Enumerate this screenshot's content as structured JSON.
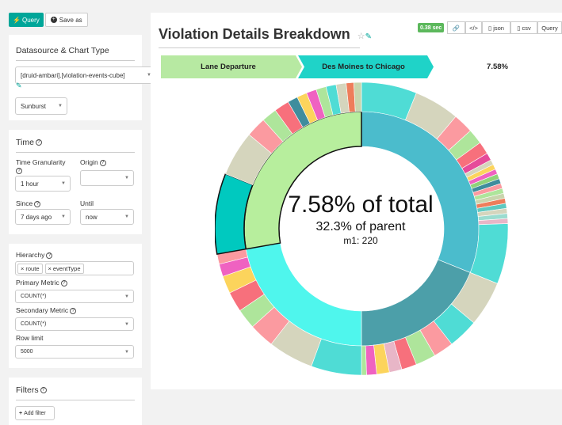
{
  "toolbar": {
    "query_label": "Query",
    "save_label": "Save as"
  },
  "datasource_panel": {
    "heading": "Datasource & Chart Type",
    "datasource_value": "[druid-ambari].[violation-events-cube]",
    "chart_type_value": "Sunburst"
  },
  "time_panel": {
    "heading": "Time",
    "granularity_label": "Time Granularity",
    "granularity_value": "1 hour",
    "origin_label": "Origin",
    "origin_value": "",
    "since_label": "Since",
    "since_value": "7 days ago",
    "until_label": "Until",
    "until_value": "now"
  },
  "query_panel": {
    "hierarchy_label": "Hierarchy",
    "hierarchy_tags": [
      "route",
      "eventType"
    ],
    "primary_metric_label": "Primary Metric",
    "primary_metric_value": "COUNT(*)",
    "secondary_metric_label": "Secondary Metric",
    "secondary_metric_value": "COUNT(*)",
    "row_limit_label": "Row limit",
    "row_limit_value": "5000"
  },
  "filters_panel": {
    "heading": "Filters",
    "add_filter_label": "Add filter"
  },
  "chart_header": {
    "title": "Violation Details Breakdown",
    "timing_badge": "0.38 sec",
    "json_label": "json",
    "csv_label": "csv",
    "query_label": "Query"
  },
  "breadcrumb": {
    "level1": "Lane Departure",
    "level2": "Des Moines to Chicago",
    "percent": "7.58%"
  },
  "center_text": {
    "total": "7.58% of total",
    "parent": "32.3% of parent",
    "metric": "m1: 220"
  },
  "colors": {
    "accent": "#00a699",
    "badge_green": "#5cb85c",
    "crumb_level1": "#b7e9a2",
    "crumb_level2": "#1fd3c8",
    "inner_blue": "#4bbccc",
    "inner_blue_dark": "#4c9fa9",
    "inner_cyan": "#4ff6ed",
    "inner_green": "#b7ee9d",
    "inner_teal": "#00c9bf"
  },
  "chart_data": {
    "type": "sunburst",
    "highlighted": {
      "path": [
        "Lane Departure",
        "Des Moines to Chicago"
      ],
      "percent_of_total": 7.58,
      "percent_of_parent": 32.3,
      "m1": 220
    }
  }
}
